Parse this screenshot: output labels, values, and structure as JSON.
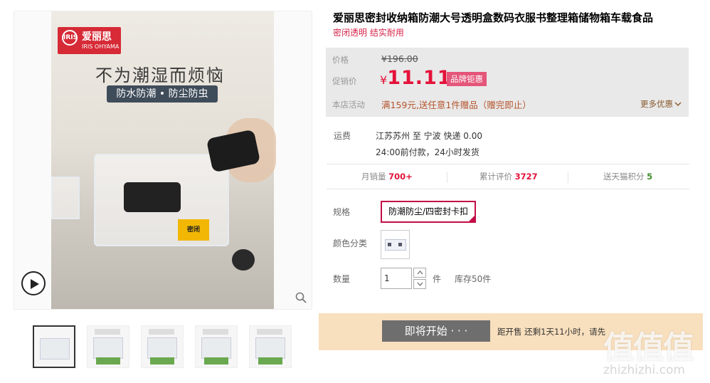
{
  "gallery": {
    "brand_cn": "爱丽思",
    "brand_short": "IRIS",
    "brand_en": "IRIS OHYAMA",
    "slogan": "不为潮湿而烦恼",
    "tagline": "防水防潮 • 防尘防虫",
    "box_label": "密闭",
    "thumbnail_count": 5
  },
  "product": {
    "title": "爱丽思密封收纳箱防潮大号透明盒数码衣服书整理箱储物箱车载食品",
    "subtitle": "密闭透明 结实耐用"
  },
  "price": {
    "price_label": "价格",
    "original": "¥196.00",
    "promo_label": "促销价",
    "currency": "¥",
    "current": "11.11",
    "badge": "品牌钜惠",
    "activity_label": "本店活动",
    "activity": "满159元,送任意1件赠品（赠完即止）",
    "more": "更多优惠"
  },
  "shipping": {
    "label": "运费",
    "line1": "江苏苏州 至 宁波 快递 0.00",
    "line2": "24:00前付款，24小时发货"
  },
  "stats": {
    "sales_label": "月销量",
    "sales_value": "700+",
    "reviews_label": "累计评价",
    "reviews_value": "3727",
    "points_label": "送天猫积分",
    "points_value": "5"
  },
  "options": {
    "spec_label": "规格",
    "spec_value": "防潮防尘/四密封卡扣",
    "color_label": "颜色分类",
    "qty_label": "数量",
    "qty_value": "1",
    "unit": "件",
    "stock": "库存50件"
  },
  "buy": {
    "button": "即将开始 · · ·",
    "countdown": "距开售 还剩1天11小时，请先"
  },
  "watermark": {
    "big": "值值值",
    "site": "zhizhizhi.com"
  },
  "colors": {
    "accent": "#e4123a",
    "badge": "#e4557a",
    "buybar": "#f8dfbd"
  }
}
